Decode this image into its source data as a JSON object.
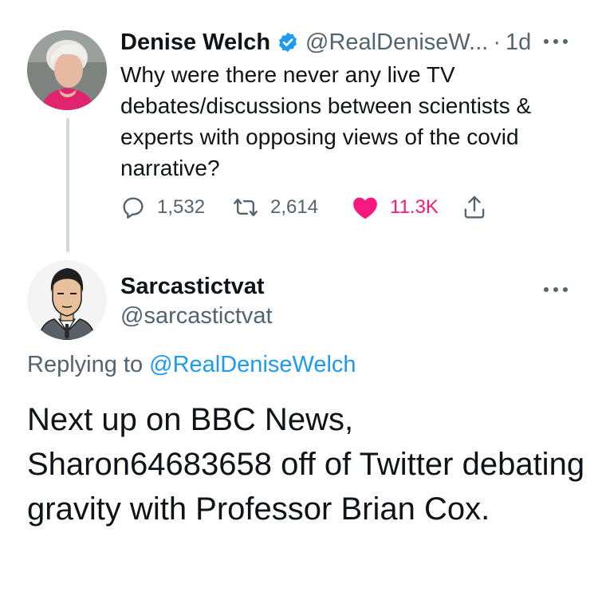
{
  "parent_tweet": {
    "display_name": "Denise Welch",
    "handle": "@RealDeniseW...",
    "separator": "·",
    "time": "1d",
    "text": "Why were there never any live TV debates/discussions between scientists & experts with opposing views of the covid narrative?",
    "counts": {
      "replies": "1,532",
      "retweets": "2,614",
      "likes": "11.3K"
    },
    "liked": true
  },
  "reply_tweet": {
    "display_name": "Sarcastictvat",
    "handle": "@sarcastictvat",
    "replying_prefix": "Replying to",
    "replying_to": "@RealDeniseWelch",
    "text": "Next up on BBC News, Sharon64683658 off of Twitter debating gravity with Professor Brian Cox."
  },
  "colors": {
    "text": "#0f1419",
    "secondary": "#536471",
    "link": "#1d9bf0",
    "like": "#f91880",
    "verified": "#1d9bf0"
  },
  "icons": [
    "verified-badge-icon",
    "more-icon",
    "reply-icon",
    "retweet-icon",
    "heart-icon",
    "share-icon"
  ]
}
